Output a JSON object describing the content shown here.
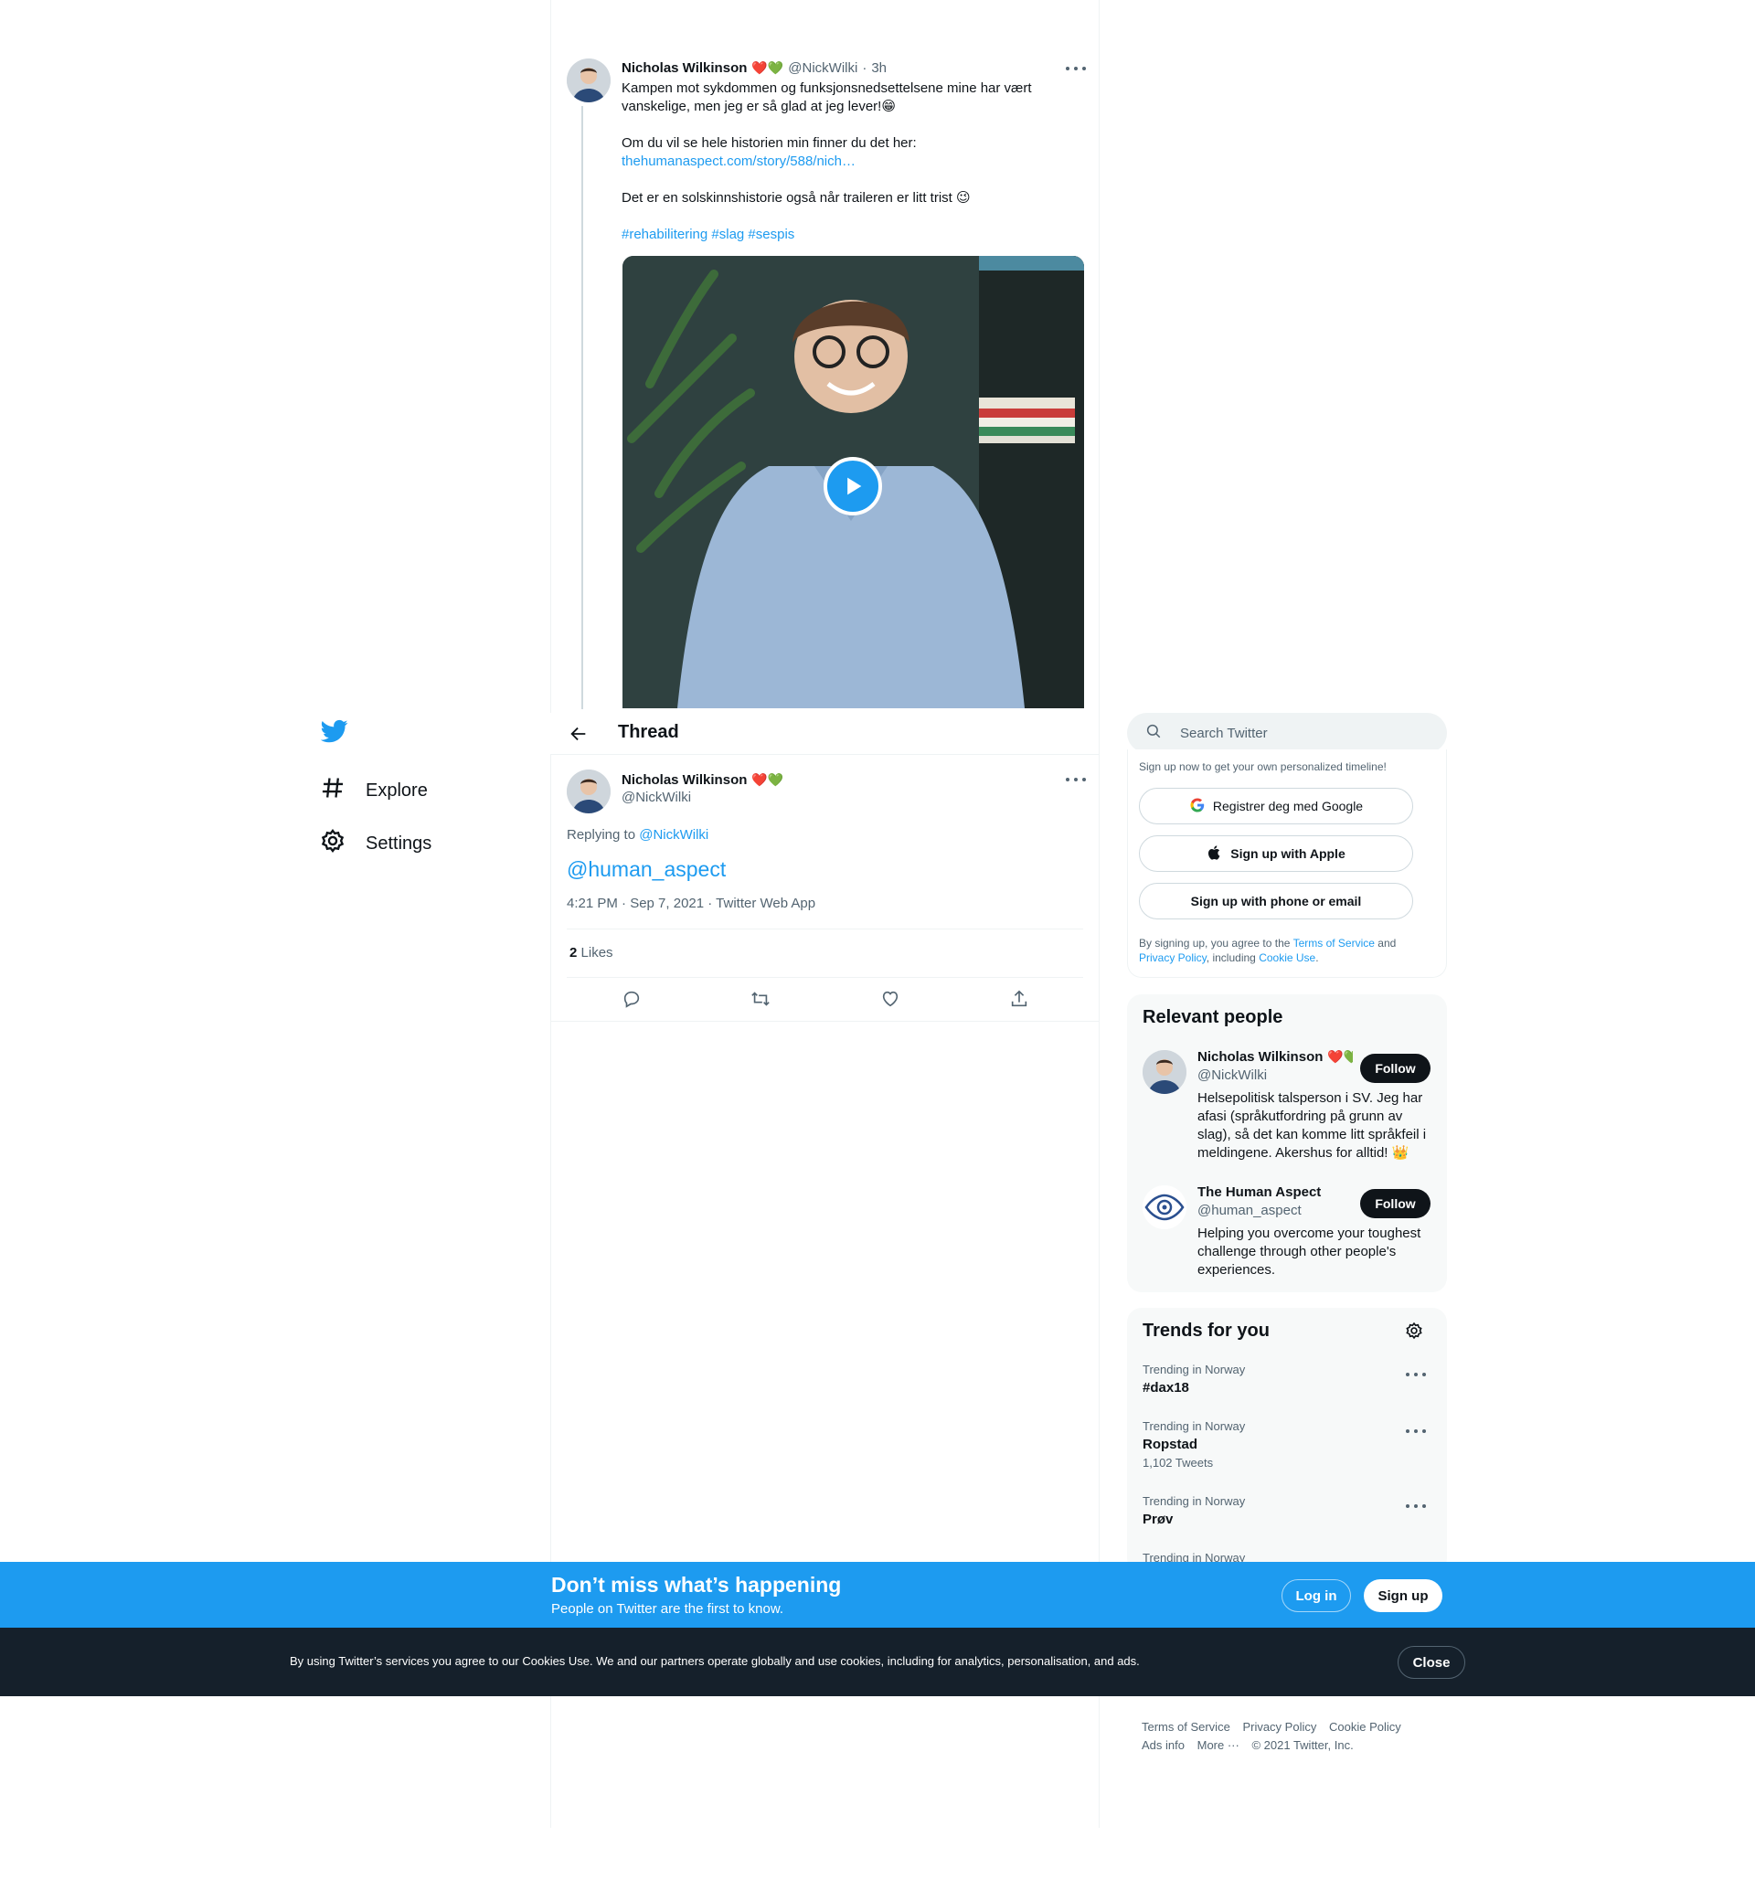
{
  "nav": {
    "items": [
      {
        "label": "Explore",
        "icon": "hashtag-icon"
      },
      {
        "label": "Settings",
        "icon": "gear-icon"
      }
    ]
  },
  "tweet_top": {
    "name": "Nicholas Wilkinson",
    "emoji": "❤️💚",
    "handle": "@NickWilki",
    "sep": "·",
    "time": "3h",
    "line1": "Kampen mot sykdommen og funksjonsnedsettelsene mine har vært",
    "line2": "vanskelige, men jeg er så glad at jeg lever!😁",
    "line3": "Om du vil se hele historien min finner du det her:",
    "link": "thehumanaspect.com/story/588/nich…",
    "line4": "Det er en solskinnshistorie også når traileren er litt trist 😉",
    "hashtags": "#rehabilitering #slag #sespis"
  },
  "thread": {
    "title": "Thread",
    "name": "Nicholas Wilkinson",
    "emoji": "❤️💚",
    "handle": "@NickWilki",
    "replying_prefix": "Replying to",
    "replying_handle": "@NickWilki",
    "mention": "@human_aspect",
    "timestamp": "4:21 PM · Sep 7, 2021 · Twitter Web App",
    "likes_count": "2",
    "likes_label": "Likes"
  },
  "sidebar": {
    "search_placeholder": "Search Twitter",
    "signup_prompt": "Sign up now to get your own personalized timeline!",
    "google_btn": "Registrer deg med Google",
    "apple_btn": "Sign up with Apple",
    "phone_btn": "Sign up with phone or email",
    "terms_prefix": "By signing up, you agree to the",
    "terms_link": "Terms of Service",
    "terms_and": "and",
    "privacy_link": "Privacy Policy",
    "including": ", including",
    "cookie_link": "Cookie Use",
    "period": "."
  },
  "relevant": {
    "title": "Relevant people",
    "people": [
      {
        "name": "Nicholas Wilkinson",
        "emoji": "❤️💚",
        "handle": "@NickWilki",
        "follow": "Follow",
        "bio1": "Helsepolitisk talsperson i SV. Jeg har",
        "bio2": "afasi (språkutfordring på grunn av",
        "bio3": "slag), så det kan komme litt språkfeil i",
        "bio4": "meldingene. Akershus for alltid! 👑"
      },
      {
        "name": "The Human Aspect",
        "handle": "@human_aspect",
        "follow": "Follow",
        "bio1": "Helping you overcome your toughest",
        "bio2": "challenge through other people's",
        "bio3": "experiences."
      }
    ]
  },
  "trends": {
    "title": "Trends for you",
    "items": [
      {
        "context": "Trending in Norway",
        "name": "#dax18",
        "count": ""
      },
      {
        "context": "Trending in Norway",
        "name": "Ropstad",
        "count": "1,102 Tweets"
      },
      {
        "context": "Trending in Norway",
        "name": "Prøv",
        "count": ""
      },
      {
        "context": "Trending in Norway",
        "name": "",
        "count": ""
      }
    ]
  },
  "banner": {
    "headline": "Don’t miss what’s happening",
    "sub": "People on Twitter are the first to know.",
    "login": "Log in",
    "signup": "Sign up"
  },
  "cookie": {
    "text": "By using Twitter’s services you agree to our Cookies Use. We and our partners operate globally and use cookies, including for analytics, personalisation, and ads.",
    "close": "Close"
  },
  "footer": {
    "terms": "Terms of Service",
    "privacy": "Privacy Policy",
    "cookie": "Cookie Policy",
    "ads": "Ads info",
    "more": "More ···",
    "copyright": "© 2021 Twitter, Inc."
  },
  "colors": {
    "accent": "#1d9bf0",
    "text": "#0f1419",
    "muted": "#536471",
    "dark": "#15202b"
  }
}
